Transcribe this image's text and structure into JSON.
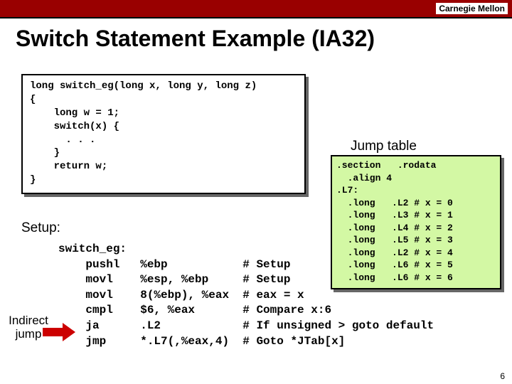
{
  "header": {
    "org": "Carnegie Mellon"
  },
  "title": "Switch Statement Example (IA32)",
  "c_code": "long switch_eg(long x, long y, long z)\n{\n    long w = 1;\n    switch(x) {\n      . . .\n    }\n    return w;\n}",
  "jump_caption": "Jump table",
  "jump_table": ".section   .rodata\n  .align 4\n.L7:\n  .long   .L2 # x = 0\n  .long   .L3 # x = 1\n  .long   .L4 # x = 2\n  .long   .L5 # x = 3\n  .long   .L2 # x = 4\n  .long   .L6 # x = 5\n  .long   .L6 # x = 6",
  "setup_label": "Setup:",
  "asm": "switch_eg:\n    pushl   %ebp           # Setup\n    movl    %esp, %ebp     # Setup\n    movl    8(%ebp), %eax  # eax = x\n    cmpl    $6, %eax       # Compare x:6\n    ja      .L2            # If unsigned > goto default\n    jmp     *.L7(,%eax,4)  # Goto *JTab[x]",
  "indirect_label": "Indirect jump",
  "pagenum": "6"
}
